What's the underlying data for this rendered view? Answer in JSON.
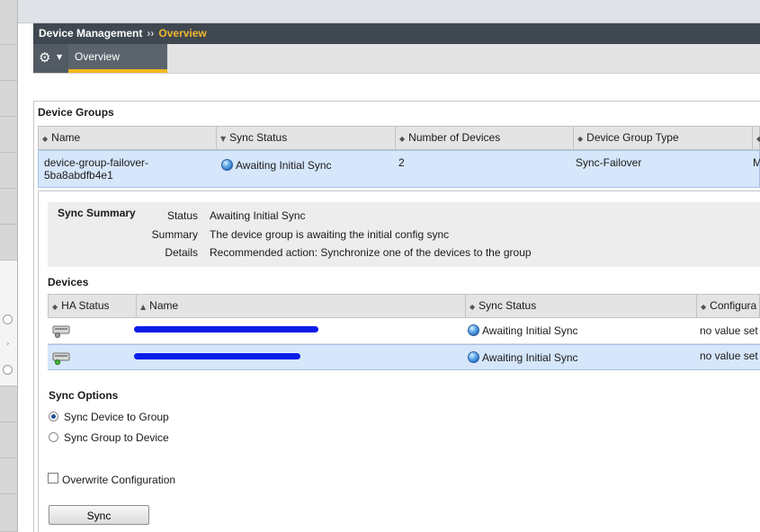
{
  "breadcrumb": {
    "section": "Device Management",
    "separator": "››",
    "current": "Overview"
  },
  "tabs": [
    {
      "label": "Overview",
      "active": true
    }
  ],
  "toolbar": {
    "settings_icon": "gear-icon"
  },
  "device_groups": {
    "title": "Device Groups",
    "columns": [
      "Name",
      "Sync Status",
      "Number of Devices",
      "Device Group Type",
      ""
    ],
    "rows": [
      {
        "name_line1": "device-group-failover-",
        "name_line2": "5ba8abdfb4e1",
        "sync_status": "Awaiting Initial Sync",
        "num_devices": "2",
        "type": "Sync-Failover",
        "extra": "M"
      }
    ]
  },
  "sync_summary": {
    "title": "Sync Summary",
    "status_label": "Status",
    "status": "Awaiting Initial Sync",
    "summary_label": "Summary",
    "summary": "The device group is awaiting the initial config sync",
    "details_label": "Details",
    "details": "Recommended action: Synchronize one of the devices to the group"
  },
  "devices": {
    "title": "Devices",
    "columns": [
      "HA Status",
      "Name",
      "Sync Status",
      "Configura"
    ],
    "rows": [
      {
        "sync_status": "Awaiting Initial Sync",
        "config": "no value set"
      },
      {
        "sync_status": "Awaiting Initial Sync",
        "config": "no value set"
      }
    ]
  },
  "sync_options": {
    "title": "Sync Options",
    "options": [
      {
        "label": "Sync Device to Group",
        "selected": true
      },
      {
        "label": "Sync Group to Device",
        "selected": false
      }
    ],
    "overwrite_label": "Overwrite Configuration",
    "overwrite_checked": false,
    "button_label": "Sync"
  },
  "colors": {
    "accent": "#f2b51d",
    "selected_row": "#d6e6fb",
    "titlebar": "#3f4850"
  }
}
